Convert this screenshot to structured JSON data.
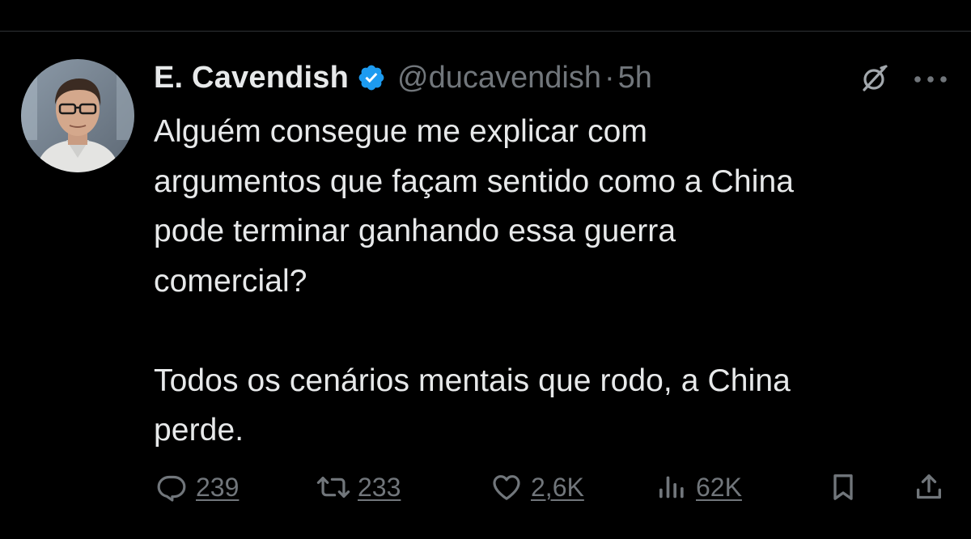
{
  "tweet": {
    "author": {
      "display_name": "E. Cavendish",
      "handle": "@ducavendish",
      "verified": true,
      "verified_icon": "verified-badge-icon"
    },
    "separator": "·",
    "time": "5h",
    "text": "Alguém consegue me explicar com\nargumentos que façam sentido como a China\npode terminar ganhando essa guerra\ncomercial?\n\nTodos os cenários mentais que rodo, a China\nperde."
  },
  "actions": {
    "reply": {
      "icon": "reply-icon",
      "count": "239"
    },
    "retweet": {
      "icon": "retweet-icon",
      "count": "233"
    },
    "like": {
      "icon": "heart-icon",
      "count": "2,6K"
    },
    "views": {
      "icon": "views-icon",
      "count": "62K"
    },
    "bookmark": {
      "icon": "bookmark-icon"
    },
    "share": {
      "icon": "share-icon"
    }
  },
  "header_icons": {
    "grok": "grok-icon",
    "more": "more-icon"
  },
  "colors": {
    "background": "#000000",
    "primary_text": "#e7e9ea",
    "secondary_text": "#71767b",
    "verified_blue": "#1d9bf0",
    "divider": "#2f3336"
  }
}
